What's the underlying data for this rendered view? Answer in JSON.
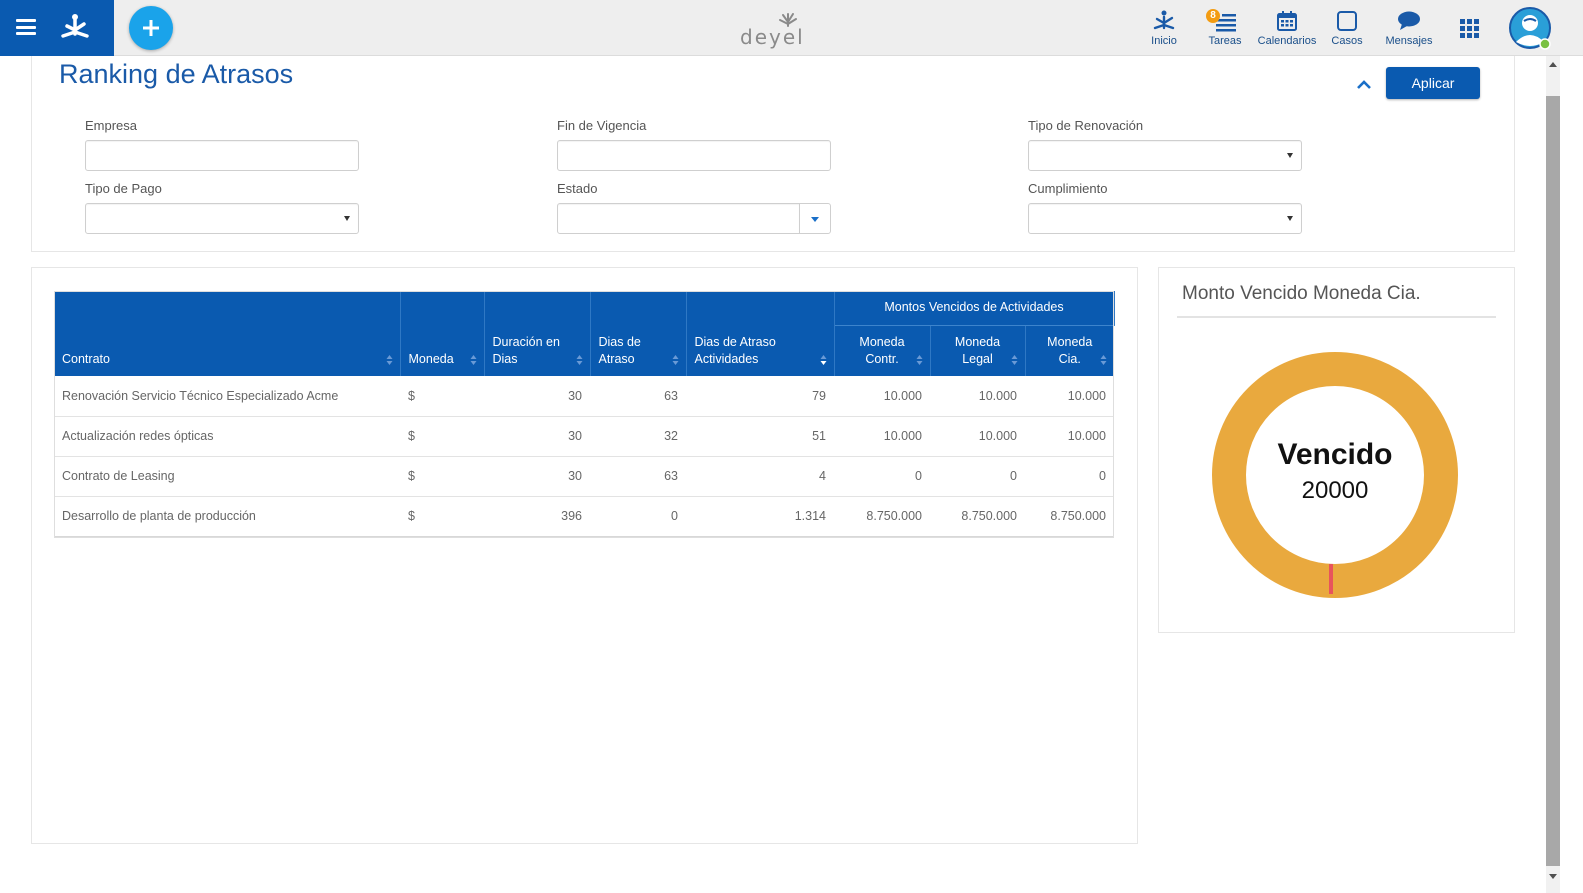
{
  "nav": {
    "items": [
      {
        "label": "Inicio",
        "icon": "home-node-icon"
      },
      {
        "label": "Tareas",
        "icon": "tasks-icon",
        "badge": "8"
      },
      {
        "label": "Calendarios",
        "icon": "calendar-icon"
      },
      {
        "label": "Casos",
        "icon": "cases-icon"
      },
      {
        "label": "Mensajes",
        "icon": "chat-bubble-icon"
      }
    ]
  },
  "filters": {
    "title": "Ranking de Atrasos",
    "apply_label": "Aplicar",
    "fields": {
      "empresa": {
        "label": "Empresa",
        "value": ""
      },
      "fin_vigencia": {
        "label": "Fin de Vigencia",
        "value": ""
      },
      "tipo_renovacion": {
        "label": "Tipo de Renovación",
        "value": ""
      },
      "tipo_pago": {
        "label": "Tipo de Pago",
        "value": ""
      },
      "estado": {
        "label": "Estado",
        "value": ""
      },
      "cumplimiento": {
        "label": "Cumplimiento",
        "value": ""
      }
    }
  },
  "table": {
    "group_header": "Montos Vencidos de Actividades",
    "columns": {
      "contrato": "Contrato",
      "moneda": "Moneda",
      "duracion_1": "Duración en",
      "duracion_2": "Dias",
      "dias_atraso_1": "Dias de",
      "dias_atraso_2": "Atraso",
      "dias_act_1": "Dias de Atraso",
      "dias_act_2": "Actividades",
      "contr_1": "Moneda",
      "contr_2": "Contr.",
      "legal_1": "Moneda",
      "legal_2": "Legal",
      "cia_1": "Moneda",
      "cia_2": "Cia."
    },
    "rows": [
      {
        "contrato": "Renovación Servicio Técnico Especializado Acme",
        "moneda": "$",
        "duracion": "30",
        "dias_atraso": "63",
        "dias_act": "79",
        "contr": "10.000",
        "legal": "10.000",
        "cia": "10.000"
      },
      {
        "contrato": "Actualización redes ópticas",
        "moneda": "$",
        "duracion": "30",
        "dias_atraso": "32",
        "dias_act": "51",
        "contr": "10.000",
        "legal": "10.000",
        "cia": "10.000"
      },
      {
        "contrato": "Contrato de Leasing",
        "moneda": "$",
        "duracion": "30",
        "dias_atraso": "63",
        "dias_act": "4",
        "contr": "0",
        "legal": "0",
        "cia": "0"
      },
      {
        "contrato": "Desarrollo de planta de producción",
        "moneda": "$",
        "duracion": "396",
        "dias_atraso": "0",
        "dias_act": "1.314",
        "contr": "8.750.000",
        "legal": "8.750.000",
        "cia": "8.750.000"
      }
    ]
  },
  "chart_data": {
    "type": "pie",
    "title": "Monto Vencido Moneda Cia.",
    "center_label": "Vencido",
    "center_value": "20000",
    "slices": [
      {
        "label": "Vencido",
        "value": 20000,
        "color": "#e9a93e"
      },
      {
        "label": "",
        "value": 0,
        "color": "#e8545c"
      }
    ]
  },
  "colors": {
    "primary": "#0a5ab0",
    "accent": "#1aa3ea",
    "donut": "#e9a93e",
    "marker": "#e8545c"
  }
}
